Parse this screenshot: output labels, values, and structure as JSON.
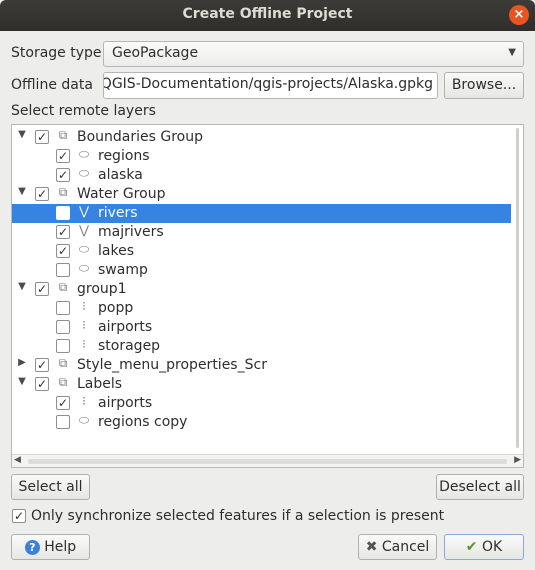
{
  "window": {
    "title": "Create Offline Project",
    "close_glyph": "×"
  },
  "storage": {
    "label": "Storage type",
    "value": "GeoPackage"
  },
  "offline": {
    "label": "Offline data",
    "value": "/QGIS-Documentation/qgis-projects/Alaska.gpkg",
    "browse_label": "Browse..."
  },
  "layers": {
    "label": "Select remote layers",
    "rows": [
      {
        "name": "Boundaries Group",
        "checked": true,
        "expander": "▼",
        "icon": "group-icon",
        "glyph": "⧉",
        "selected": false
      },
      {
        "name": "regions",
        "checked": true,
        "expander": "",
        "icon": "polygon-icon",
        "glyph": "⬭",
        "selected": false
      },
      {
        "name": "alaska",
        "checked": true,
        "expander": "",
        "icon": "polygon-icon",
        "glyph": "⬭",
        "selected": false
      },
      {
        "name": "Water Group",
        "checked": true,
        "expander": "▼",
        "icon": "group-icon",
        "glyph": "⧉",
        "selected": false
      },
      {
        "name": "rivers",
        "checked": false,
        "expander": "",
        "icon": "line-icon",
        "glyph": "⋁",
        "selected": true
      },
      {
        "name": "majrivers",
        "checked": true,
        "expander": "",
        "icon": "line-icon",
        "glyph": "⋁",
        "selected": false
      },
      {
        "name": "lakes",
        "checked": true,
        "expander": "",
        "icon": "polygon-icon",
        "glyph": "⬭",
        "selected": false
      },
      {
        "name": "swamp",
        "checked": false,
        "expander": "",
        "icon": "polygon-icon",
        "glyph": "⬭",
        "selected": false
      },
      {
        "name": "group1",
        "checked": true,
        "expander": "▼",
        "icon": "group-icon",
        "glyph": "⧉",
        "selected": false
      },
      {
        "name": "popp",
        "checked": false,
        "expander": "",
        "icon": "point-icon",
        "glyph": "⁝",
        "selected": false
      },
      {
        "name": "airports",
        "checked": false,
        "expander": "",
        "icon": "point-icon",
        "glyph": "⁝",
        "selected": false
      },
      {
        "name": "storagep",
        "checked": false,
        "expander": "",
        "icon": "point-icon",
        "glyph": "⁝",
        "selected": false
      },
      {
        "name": "Style_menu_properties_Scr",
        "checked": true,
        "expander": "▶",
        "icon": "group-icon",
        "glyph": "⧉",
        "selected": false
      },
      {
        "name": "Labels",
        "checked": true,
        "expander": "▼",
        "icon": "group-icon",
        "glyph": "⧉",
        "selected": false
      },
      {
        "name": "airports",
        "checked": true,
        "expander": "",
        "icon": "point-icon",
        "glyph": "⁝",
        "selected": false
      },
      {
        "name": "regions copy",
        "checked": false,
        "expander": "",
        "icon": "polygon-icon",
        "glyph": "⬭",
        "selected": false
      }
    ]
  },
  "buttons": {
    "select_all": "Select all",
    "deselect_all": "Deselect all",
    "help": "Help",
    "cancel": "Cancel",
    "ok": "OK"
  },
  "sync": {
    "label": "Only synchronize selected features if a selection is present",
    "checked": true
  },
  "check_glyph": "✓"
}
